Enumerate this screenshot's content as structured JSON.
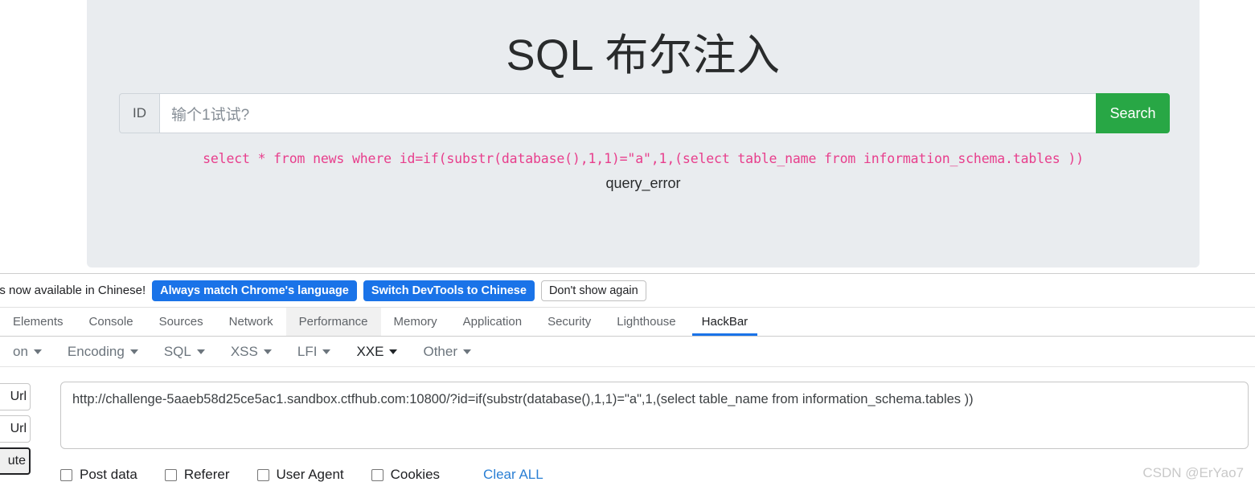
{
  "page": {
    "title": "SQL 布尔注入",
    "input_group": {
      "prepend_label": "ID",
      "value": "",
      "placeholder": "输个1试试?",
      "submit_label": "Search"
    },
    "query_sql": "select * from news where id=if(substr(database(),1,1)=\"a\",1,(select table_name from information_schema.tables ))",
    "query_result": "query_error",
    "accent_green": "#28a745",
    "sql_pink": "#e83e8c",
    "jumbotron_bg": "#e9ecef"
  },
  "devtools": {
    "language_banner": {
      "message": "is now available in Chinese!",
      "buttons": [
        {
          "label": "Always match Chrome's language",
          "style": "primary"
        },
        {
          "label": "Switch DevTools to Chinese",
          "style": "primary"
        },
        {
          "label": "Don't show again",
          "style": "secondary"
        }
      ],
      "accent": "#1a73e8"
    },
    "tabs": [
      {
        "label": "Elements",
        "state": "normal"
      },
      {
        "label": "Console",
        "state": "normal"
      },
      {
        "label": "Sources",
        "state": "normal"
      },
      {
        "label": "Network",
        "state": "normal"
      },
      {
        "label": "Performance",
        "state": "hovered"
      },
      {
        "label": "Memory",
        "state": "normal"
      },
      {
        "label": "Application",
        "state": "normal"
      },
      {
        "label": "Security",
        "state": "normal"
      },
      {
        "label": "Lighthouse",
        "state": "normal"
      },
      {
        "label": "HackBar",
        "state": "active"
      }
    ],
    "hackbar": {
      "menu": [
        {
          "label": "on",
          "state": "normal"
        },
        {
          "label": "Encoding",
          "state": "normal"
        },
        {
          "label": "SQL",
          "state": "normal"
        },
        {
          "label": "XSS",
          "state": "normal"
        },
        {
          "label": "LFI",
          "state": "normal"
        },
        {
          "label": "XXE",
          "state": "dark"
        },
        {
          "label": "Other",
          "state": "normal"
        }
      ],
      "side_buttons": [
        {
          "label": "Url",
          "style": "normal"
        },
        {
          "label": "Url",
          "style": "normal"
        },
        {
          "label": "ute",
          "style": "emphasis"
        }
      ],
      "url_value": "http://challenge-5aaeb58d25ce5ac1.sandbox.ctfhub.com:10800/?id=if(substr(database(),1,1)=\"a\",1,(select table_name from information_schema.tables ))",
      "checkboxes": [
        {
          "label": "Post data",
          "checked": false
        },
        {
          "label": "Referer",
          "checked": false
        },
        {
          "label": "User Agent",
          "checked": false
        },
        {
          "label": "Cookies",
          "checked": false
        }
      ],
      "clear_all_label": "Clear ALL"
    }
  },
  "watermark": "CSDN @ErYao7"
}
